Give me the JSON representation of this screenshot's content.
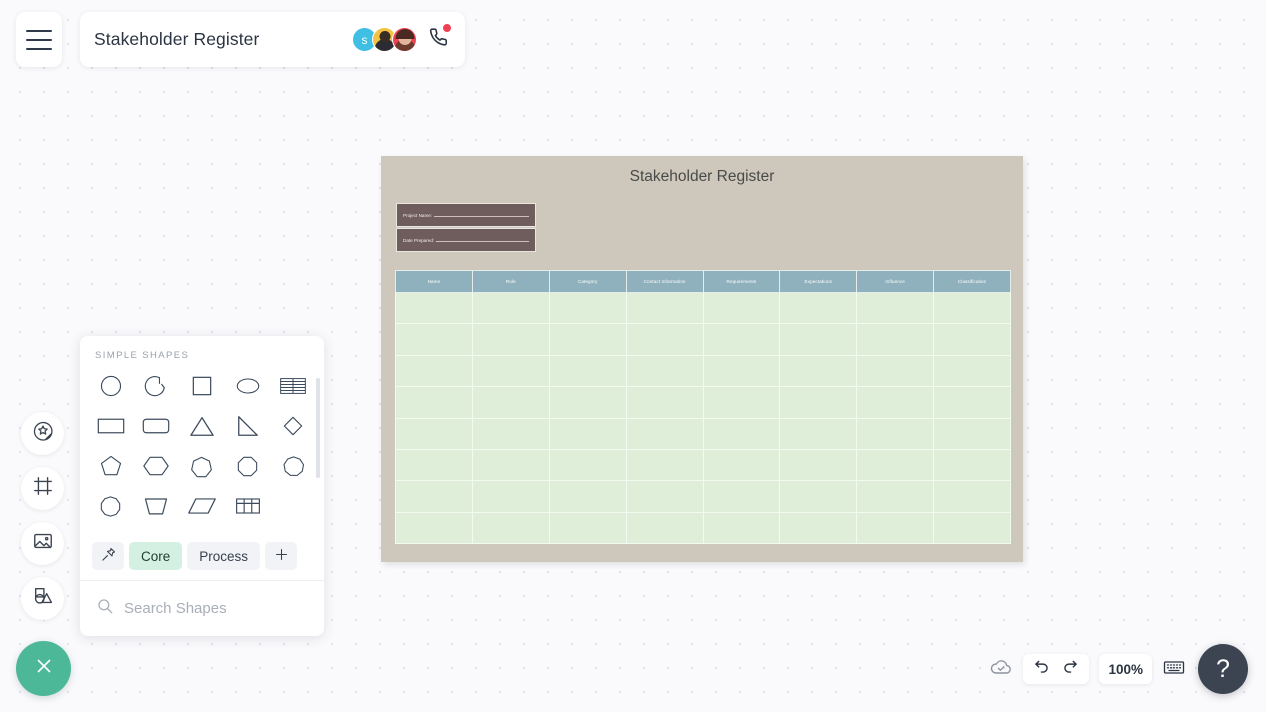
{
  "app": {
    "document_title": "Stakeholder Register",
    "menu_icon": "hamburger-icon",
    "call_icon": "phone-icon"
  },
  "collaborators": [
    {
      "id": "avatar-1",
      "initial": "s",
      "color": "#3ebfe3",
      "type": "initial"
    },
    {
      "id": "avatar-2",
      "initial": "",
      "color": "#f5c343",
      "type": "photo"
    },
    {
      "id": "avatar-3",
      "initial": "",
      "color": "#ef4154",
      "type": "photo"
    }
  ],
  "left_rail": [
    {
      "name": "sticker-icon",
      "label": "Stickers"
    },
    {
      "name": "frame-icon",
      "label": "Frames"
    },
    {
      "name": "image-icon",
      "label": "Images"
    },
    {
      "name": "shapes-icon",
      "label": "Shapes"
    }
  ],
  "close_fab": {
    "icon": "close-icon",
    "color": "#4cb898"
  },
  "shapes_panel": {
    "heading": "SIMPLE SHAPES",
    "shapes": [
      {
        "name": "circle-shape"
      },
      {
        "name": "arc-shape"
      },
      {
        "name": "square-shape"
      },
      {
        "name": "ellipse-shape"
      },
      {
        "name": "lined-table-shape"
      },
      {
        "name": "rectangle-shape"
      },
      {
        "name": "rounded-rectangle-shape"
      },
      {
        "name": "triangle-shape"
      },
      {
        "name": "right-triangle-shape"
      },
      {
        "name": "diamond-shape"
      },
      {
        "name": "pentagon-shape"
      },
      {
        "name": "hexagon-shape"
      },
      {
        "name": "heptagon-shape"
      },
      {
        "name": "octagon-shape"
      },
      {
        "name": "nonagon-shape"
      },
      {
        "name": "decagon-shape"
      },
      {
        "name": "trapezoid-shape"
      },
      {
        "name": "parallelogram-shape"
      },
      {
        "name": "grid-table-shape"
      }
    ],
    "tabs": [
      {
        "name": "pin-tab",
        "label": "",
        "icon": "pin-icon",
        "active": false
      },
      {
        "name": "tab-core",
        "label": "Core",
        "icon": "",
        "active": true
      },
      {
        "name": "tab-process",
        "label": "Process",
        "icon": "",
        "active": false
      },
      {
        "name": "tab-add",
        "label": "",
        "icon": "plus-icon",
        "active": false
      }
    ],
    "search": {
      "placeholder": "Search Shapes",
      "value": "",
      "icon": "search-icon",
      "more_icon": "more-vertical-icon"
    },
    "active_tab_color": "#d4f0e2"
  },
  "canvas": {
    "background_color": "#cdc8bb",
    "title": "Stakeholder Register",
    "fields": [
      {
        "name": "project-name-field",
        "label": "Project Name:"
      },
      {
        "name": "date-prepared-field",
        "label": "Date Prepared:"
      }
    ],
    "field_color": "#6f5d5d",
    "table": {
      "header_color": "#8fb0bd",
      "cell_color": "#dfeed8",
      "columns": [
        "Name",
        "Role",
        "Category",
        "Contact Information",
        "Requirements",
        "Expectations",
        "Influence",
        "Classification"
      ],
      "row_count": 8,
      "rows": [
        [
          "",
          "",
          "",
          "",
          "",
          "",
          "",
          ""
        ],
        [
          "",
          "",
          "",
          "",
          "",
          "",
          "",
          ""
        ],
        [
          "",
          "",
          "",
          "",
          "",
          "",
          "",
          ""
        ],
        [
          "",
          "",
          "",
          "",
          "",
          "",
          "",
          ""
        ],
        [
          "",
          "",
          "",
          "",
          "",
          "",
          "",
          ""
        ],
        [
          "",
          "",
          "",
          "",
          "",
          "",
          "",
          ""
        ],
        [
          "",
          "",
          "",
          "",
          "",
          "",
          "",
          ""
        ],
        [
          "",
          "",
          "",
          "",
          "",
          "",
          "",
          ""
        ]
      ]
    }
  },
  "bottom_bar": {
    "save_status_icon": "cloud-check-icon",
    "undo_icon": "undo-icon",
    "redo_icon": "redo-icon",
    "zoom_level": "100%",
    "keyboard_icon": "keyboard-icon",
    "help_label": "?"
  }
}
